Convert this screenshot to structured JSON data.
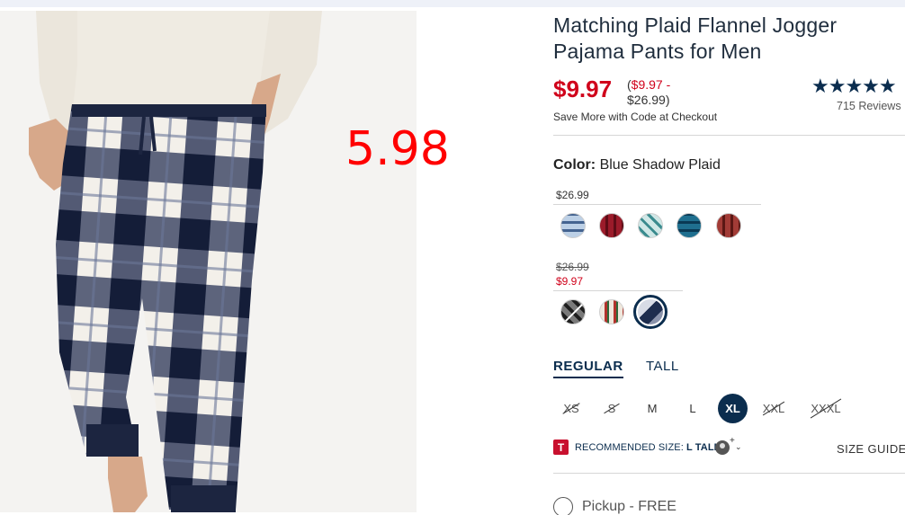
{
  "overlay": {
    "price_text": "5.98"
  },
  "product": {
    "title": "Matching Plaid Flannel Jogger Pajama Pants for Men",
    "price_now": "$9.97",
    "price_range_open": "(",
    "price_range_low": "$9.97 -",
    "price_range_high": "$26.99)",
    "promo": "Save More with Code at Checkout"
  },
  "rating": {
    "stars": "★★★★★",
    "reviews": "715 Reviews"
  },
  "color": {
    "label": "Color:",
    "value": "Blue Shadow Plaid"
  },
  "tiers": [
    {
      "price": "$26.99",
      "swatches": [
        {
          "name": "light-blue-plaid",
          "base": "#dbe6f2",
          "stripe": "#4f6e98"
        },
        {
          "name": "red-plaid",
          "base": "#9b1b2a",
          "stripe": "#5e0c16"
        },
        {
          "name": "teal-plaid",
          "base": "#cfe7e6",
          "stripe": "#3a8b8e"
        },
        {
          "name": "blue-teal-plaid",
          "base": "#1f6f8f",
          "stripe": "#0a3a55"
        },
        {
          "name": "burgundy-plaid",
          "base": "#a23b36",
          "stripe": "#5a1714"
        }
      ]
    },
    {
      "price_original": "$26.99",
      "price_sale": "$9.97",
      "swatches": [
        {
          "name": "black-white-plaid",
          "base": "#7a7a7a",
          "stripe": "#1e1e1e",
          "unavailable": true
        },
        {
          "name": "holiday-plaid",
          "base": "#efe7dc",
          "stripe": "#b2332c"
        },
        {
          "name": "blue-shadow-plaid",
          "base": "#d8dce6",
          "stripe": "#1e2d4e",
          "selected": true
        }
      ]
    }
  ],
  "fit": {
    "regular": "REGULAR",
    "tall": "TALL",
    "active": "REGULAR"
  },
  "sizes": [
    {
      "label": "XS",
      "available": false
    },
    {
      "label": "S",
      "available": false
    },
    {
      "label": "M",
      "available": true
    },
    {
      "label": "L",
      "available": true
    },
    {
      "label": "XL",
      "available": true,
      "selected": true
    },
    {
      "label": "XXL",
      "available": false
    },
    {
      "label": "XXXL",
      "available": false
    }
  ],
  "recommended": {
    "icon_letter": "T",
    "label": "RECOMMENDED SIZE:",
    "value": "L TALL",
    "plus": "+",
    "chevron": "⌄",
    "size_guide": "SIZE GUIDE"
  },
  "pickup": {
    "label": "Pickup - FREE"
  },
  "colors": {
    "brand_navy": "#0b2d4e",
    "sale_red": "#d0021b",
    "overlay_red": "#ff0000"
  }
}
